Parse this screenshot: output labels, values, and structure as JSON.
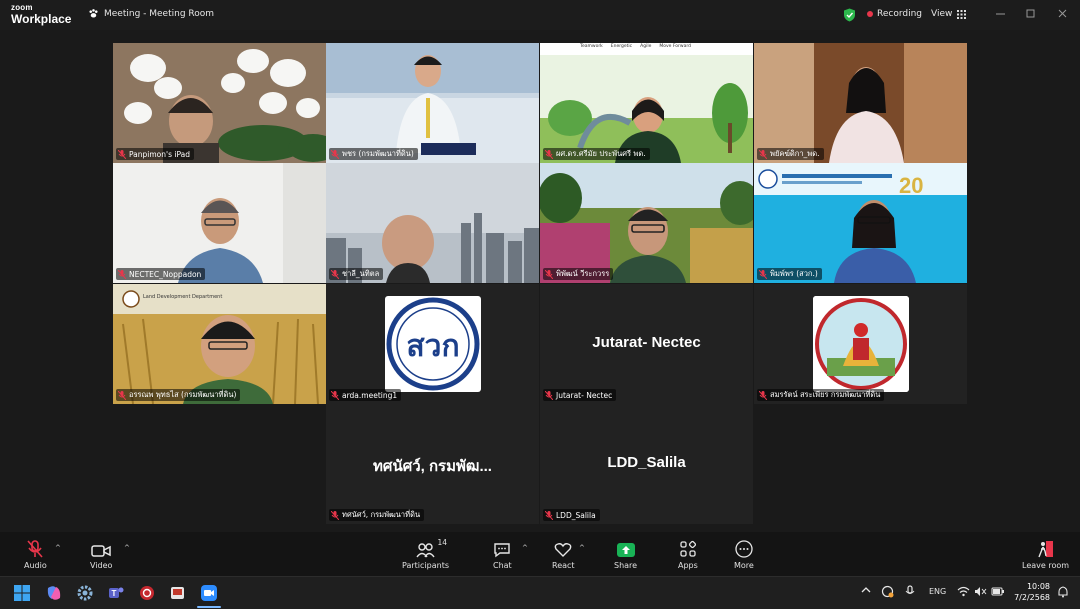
{
  "app": {
    "logo_line1": "zoom",
    "logo_line2": "Workplace",
    "meeting_title": "Meeting - Meeting Room",
    "recording_label": "Recording",
    "view_label": "View",
    "icons": [
      "meeting-paw-icon",
      "shield-check-icon",
      "grid-icon",
      "minimize-icon",
      "maximize-icon",
      "close-icon"
    ]
  },
  "participants": [
    {
      "name": "Panpimon's iPad",
      "muted": true
    },
    {
      "name": "พชร (กรมพัฒนาที่ดิน)",
      "muted": true
    },
    {
      "name": "ผศ.ดร.ศรีมัย ประพันศรี พด.",
      "muted": true,
      "active_speaker": true
    },
    {
      "name": "พยัคฆ์ดิกา_พด.",
      "muted": true
    },
    {
      "name": "NECTEC_Noppadon",
      "muted": true
    },
    {
      "name": "ชาลี_นทิตล",
      "muted": true
    },
    {
      "name": "พิพัฒน์ วีระกวรร",
      "muted": true
    },
    {
      "name": "พิมพ์พร (สวก.)",
      "muted": true
    },
    {
      "name": "อรรณพ พุทธไส (กรมพัฒนาที่ดิน)",
      "muted": true
    },
    {
      "name": "arda.meeting1",
      "muted": true
    },
    {
      "name": "Jutarat- Nectec",
      "muted": true,
      "display_name": "Jutarat- Nectec"
    },
    {
      "name": "สมรรัตน์ สระเพียร กรมพัฒนาที่ดิน",
      "muted": true
    },
    {
      "name": "ทศนัศว์, กรมพัฒนาที่ดิน",
      "muted": true,
      "display_name": "ทศนัศว์, กรมพัฒ..."
    },
    {
      "name": "LDD_Salila",
      "muted": true,
      "display_name": "LDD_Salila"
    }
  ],
  "tile_text": {
    "slide_banner": [
      "Teamwork",
      "Energetic",
      "Agile",
      "Move Forward"
    ],
    "ldd_banner": "Land Development Department",
    "arda_logo_text": "สวก",
    "arda_banner_num": "20"
  },
  "toolbar": {
    "audio": "Audio",
    "video": "Video",
    "participants": "Participants",
    "participants_count": "14",
    "chat": "Chat",
    "react": "React",
    "share": "Share",
    "apps": "Apps",
    "more": "More",
    "leave": "Leave room"
  },
  "taskbar": {
    "lang": "ENG",
    "time": "10:08",
    "date": "7/2/2568"
  },
  "colors": {
    "active_border": "#23d959",
    "recording_dot": "#e8364b",
    "share_green": "#19b356",
    "muted_red": "#e8364b"
  }
}
